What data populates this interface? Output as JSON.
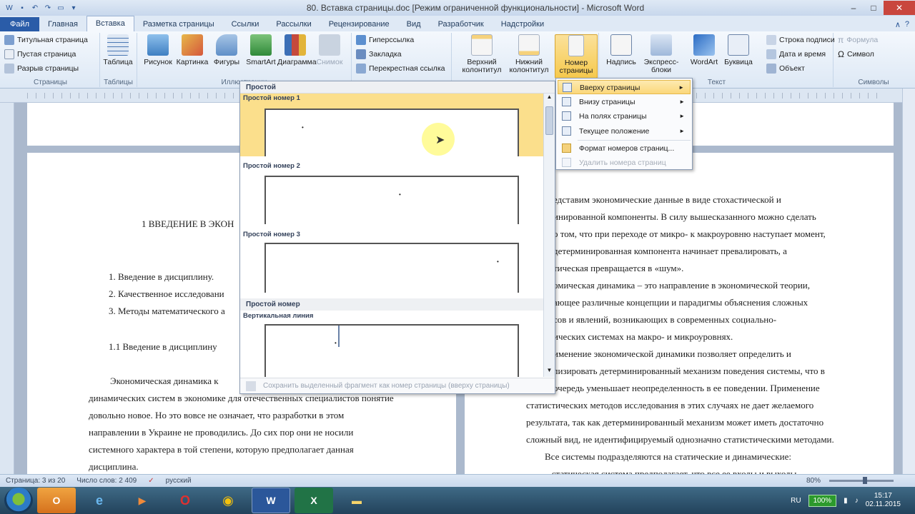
{
  "window": {
    "title": "80. Вставка страницы.doc [Режим ограниченной функциональности] - Microsoft Word",
    "controls": {
      "min": "–",
      "max": "□",
      "close": "✕"
    }
  },
  "tabs": [
    {
      "label": "Файл"
    },
    {
      "label": "Главная"
    },
    {
      "label": "Вставка"
    },
    {
      "label": "Разметка страницы"
    },
    {
      "label": "Ссылки"
    },
    {
      "label": "Рассылки"
    },
    {
      "label": "Рецензирование"
    },
    {
      "label": "Вид"
    },
    {
      "label": "Разработчик"
    },
    {
      "label": "Надстройки"
    }
  ],
  "ribbon": {
    "pages": {
      "label": "Страницы",
      "items": [
        "Титульная страница",
        "Пустая страница",
        "Разрыв страницы"
      ]
    },
    "tables": {
      "label": "Таблицы",
      "table": "Таблица"
    },
    "illustrations": {
      "label": "Иллюстрации",
      "items": [
        "Рисунок",
        "Картинка",
        "Фигуры",
        "SmartArt",
        "Диаграмма",
        "Снимок"
      ]
    },
    "links": {
      "items": [
        "Гиперссылка",
        "Закладка",
        "Перекрестная ссылка"
      ]
    },
    "header_footer": {
      "header": "Верхний колонтитул",
      "footer": "Нижний колонтитул",
      "page_number": "Номер страницы"
    },
    "text": {
      "label": "Текст",
      "items": [
        "Надпись",
        "Экспресс-блоки",
        "WordArt",
        "Буквица"
      ],
      "small": [
        "Строка подписи",
        "Дата и время",
        "Объект"
      ]
    },
    "symbols": {
      "label": "Символы",
      "items": [
        "Формула",
        "Символ"
      ]
    }
  },
  "gallery": {
    "header": "Простой",
    "items": [
      {
        "label": "Простой номер 1",
        "highlighted": true
      },
      {
        "label": "Простой номер 2",
        "highlighted": false
      },
      {
        "label": "Простой номер 3",
        "highlighted": false
      }
    ],
    "section2_header": "Простой номер",
    "section2_item": "Вертикальная линия",
    "footer": "Сохранить выделенный фрагмент как номер страницы (вверху страницы)"
  },
  "submenu": {
    "items": [
      {
        "label": "Вверху страницы",
        "arrow": "►",
        "highlighted": true
      },
      {
        "label": "Внизу страницы",
        "arrow": "►"
      },
      {
        "label": "На полях страницы",
        "arrow": "►"
      },
      {
        "label": "Текущее положение",
        "arrow": "►"
      },
      {
        "label": "Формат номеров страниц..."
      },
      {
        "label": "Удалить номера страниц",
        "disabled": true
      }
    ]
  },
  "document": {
    "left": {
      "heading": "1  ВВЕДЕНИЕ В ЭКОН",
      "list": [
        "1.  Введение в дисциплину.",
        "2.  Качественное исследовани",
        "3.  Методы математического а"
      ],
      "subheading": "1.1  Введение в дисциплину",
      "para1": "Экономическая динамика к",
      "para_lines": [
        "динамических систем в экономике для отечественных специалистов понятие",
        "довольно новое. Но это вовсе не означает, что разработки в этом",
        "направлении в Украине не проводились. До сих пор они не носили",
        "системного характера в той степени, которую предполагает данная",
        "дисциплина."
      ]
    },
    "right": {
      "lines": [
        "едставим экономические данные в виде стохастической и",
        "инированной компоненты. В силу вышесказанного можно сделать",
        "о том, что при переходе от микро- к макроуровню наступает момент,",
        "детерминированная компонента начинает превалировать,  а",
        "тическая превращается в «шум».",
        "омическая динамика – это направление в экономической теории,",
        "ающее различные концепции и парадигмы объяснения сложных",
        "сов и явлений, возникающих в современных социально-",
        "ических системах на макро- и микроуровнях.",
        "именение экономической динамики позволяет определить и",
        "лизировать детерминированный механизм поведения системы, что в",
        "очередь уменьшает неопределенность в ее поведении. Применение",
        "статистических методов исследования в этих случаях не дает желаемого",
        "результата, так как детерминированный механизм может иметь достаточно",
        "сложный вид, не идентифицируемый однозначно статистическими методами.",
        "Все системы подразделяются на статические и динамические:",
        "–  статическая система предполагает, что все ее входы и выходы"
      ]
    }
  },
  "status": {
    "page": "Страница: 3 из 20",
    "words": "Число слов: 2 409",
    "lang": "русский",
    "zoom": "80%",
    "zoom_level": 0.55
  },
  "taskbar": {
    "lang": "RU",
    "battery": "100%",
    "time": "15:17",
    "date": "02.11.2015"
  },
  "colors": {
    "accent": "#2a5ca8",
    "highlight": "#fbdf8c",
    "taskbar": "#2e5571"
  }
}
